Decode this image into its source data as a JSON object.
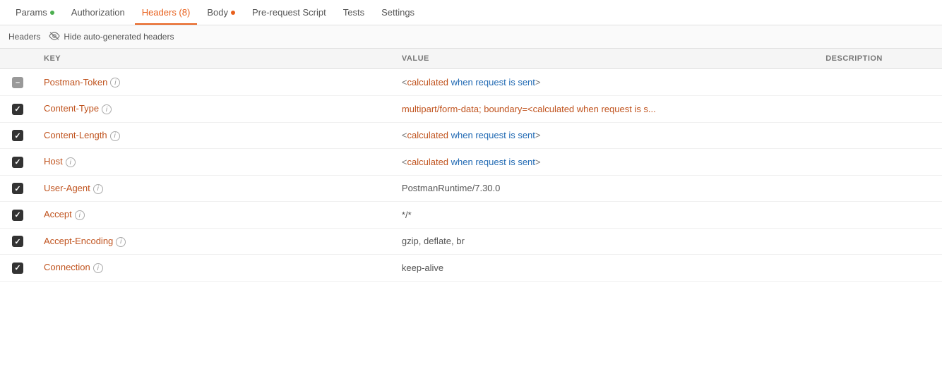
{
  "tabs": [
    {
      "id": "params",
      "label": "Params",
      "dot": "green",
      "active": false
    },
    {
      "id": "authorization",
      "label": "Authorization",
      "dot": null,
      "active": false
    },
    {
      "id": "headers",
      "label": "Headers",
      "badge": "8",
      "active": true
    },
    {
      "id": "body",
      "label": "Body",
      "dot": "orange",
      "active": false
    },
    {
      "id": "pre-request-script",
      "label": "Pre-request Script",
      "dot": null,
      "active": false
    },
    {
      "id": "tests",
      "label": "Tests",
      "dot": null,
      "active": false
    },
    {
      "id": "settings",
      "label": "Settings",
      "dot": null,
      "active": false
    }
  ],
  "subtoolbar": {
    "label": "Headers",
    "action_label": "Hide auto-generated headers"
  },
  "table": {
    "columns": [
      {
        "id": "check",
        "label": ""
      },
      {
        "id": "key",
        "label": "KEY"
      },
      {
        "id": "value",
        "label": "VALUE"
      },
      {
        "id": "description",
        "label": "DESCRIPTION"
      }
    ],
    "rows": [
      {
        "checked": "partial",
        "key": "Postman-Token",
        "key_color": "orange",
        "info": true,
        "value": "<calculated when request is sent>",
        "value_style": "calculated",
        "description": ""
      },
      {
        "checked": true,
        "key": "Content-Type",
        "key_color": "orange",
        "info": true,
        "value": "multipart/form-data; boundary=<calculated when request is s...",
        "value_style": "mixed_orange",
        "description": ""
      },
      {
        "checked": true,
        "key": "Content-Length",
        "key_color": "orange",
        "info": true,
        "value": "<calculated when request is sent>",
        "value_style": "calculated",
        "description": ""
      },
      {
        "checked": true,
        "key": "Host",
        "key_color": "orange",
        "info": true,
        "value": "<calculated when request is sent>",
        "value_style": "calculated",
        "description": ""
      },
      {
        "checked": true,
        "key": "User-Agent",
        "key_color": "orange",
        "info": true,
        "value": "PostmanRuntime/7.30.0",
        "value_style": "plain",
        "description": ""
      },
      {
        "checked": true,
        "key": "Accept",
        "key_color": "orange",
        "info": true,
        "value": "*/*",
        "value_style": "plain",
        "description": ""
      },
      {
        "checked": true,
        "key": "Accept-Encoding",
        "key_color": "orange",
        "info": true,
        "value": "gzip, deflate, br",
        "value_style": "plain",
        "description": ""
      },
      {
        "checked": true,
        "key": "Connection",
        "key_color": "orange",
        "info": true,
        "value": "keep-alive",
        "value_style": "plain",
        "description": ""
      }
    ]
  }
}
